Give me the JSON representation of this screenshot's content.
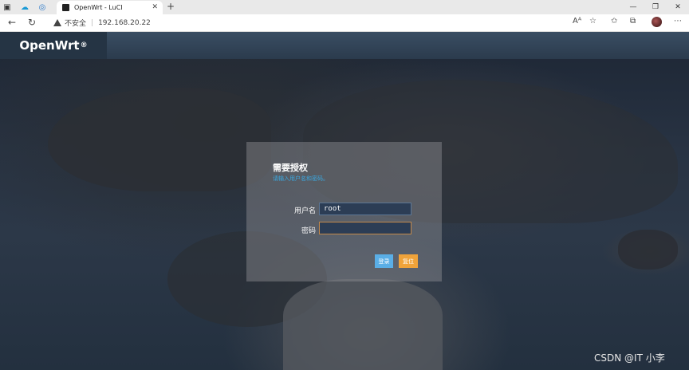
{
  "browser": {
    "tab_title": "OpenWrt - LuCI",
    "security_label": "不安全",
    "url": "192.168.20.22"
  },
  "header": {
    "brand": "OpenWrt",
    "brand_mark": "®"
  },
  "login": {
    "title": "需要授权",
    "subtitle": "请输入用户名和密码。",
    "username_label": "用户名",
    "username_value": "root",
    "password_label": "密码",
    "password_value": "",
    "login_button": "登录",
    "reset_button": "复位"
  },
  "overlay": {
    "watermark": "CSDN @IT 小李"
  },
  "colors": {
    "login_button": "#5aaee6",
    "reset_button": "#f0a33a",
    "subtitle": "#3aa8e0"
  }
}
